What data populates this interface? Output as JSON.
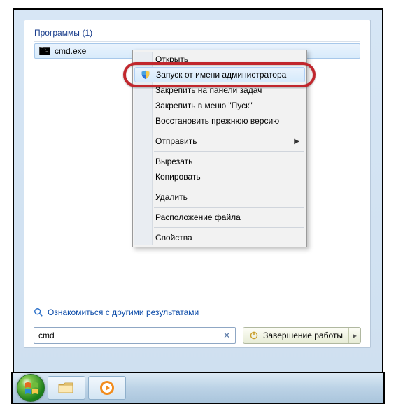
{
  "section": {
    "title_prefix": "Программы",
    "count": "(1)"
  },
  "result": {
    "name": "cmd.exe"
  },
  "context_menu": {
    "open": "Открыть",
    "run_as_admin": "Запуск от имени администратора",
    "pin_taskbar": "Закрепить на панели задач",
    "pin_start": "Закрепить в меню \"Пуск\"",
    "restore_prev": "Восстановить прежнюю версию",
    "send_to": "Отправить",
    "cut": "Вырезать",
    "copy": "Копировать",
    "delete": "Удалить",
    "file_location": "Расположение файла",
    "properties": "Свойства"
  },
  "more_results": "Ознакомиться с другими результатами",
  "search": {
    "value": "cmd"
  },
  "shutdown": {
    "label": "Завершение работы"
  }
}
